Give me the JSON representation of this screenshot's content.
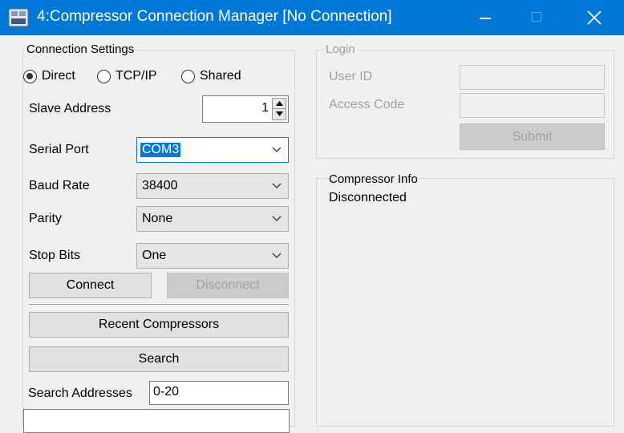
{
  "window": {
    "title": "4:Compressor Connection Manager [No Connection]",
    "accent_color": "#0078d7",
    "controls": [
      "minimize-icon",
      "maximize-icon",
      "close-icon"
    ]
  },
  "connection_settings": {
    "group_title": "Connection Settings",
    "modes": [
      {
        "label": "Direct",
        "checked": true
      },
      {
        "label": "TCP/IP",
        "checked": false
      },
      {
        "label": "Shared",
        "checked": false
      }
    ],
    "slave_address_label": "Slave Address",
    "slave_address_value": "1",
    "serial_port_label": "Serial Port",
    "serial_port_value": "COM3",
    "baud_rate_label": "Baud Rate",
    "baud_rate_value": "38400",
    "parity_label": "Parity",
    "parity_value": "None",
    "stop_bits_label": "Stop Bits",
    "stop_bits_value": "One",
    "connect_label": "Connect",
    "disconnect_label": "Disconnect",
    "recent_label": "Recent Compressors",
    "search_label": "Search",
    "search_addresses_label": "Search Addresses",
    "search_addresses_value": "0-20"
  },
  "login": {
    "group_title": "Login",
    "user_id_label": "User ID",
    "access_code_label": "Access Code",
    "submit_label": "Submit"
  },
  "compressor_info": {
    "group_title": "Compressor Info",
    "status": "Disconnected"
  }
}
